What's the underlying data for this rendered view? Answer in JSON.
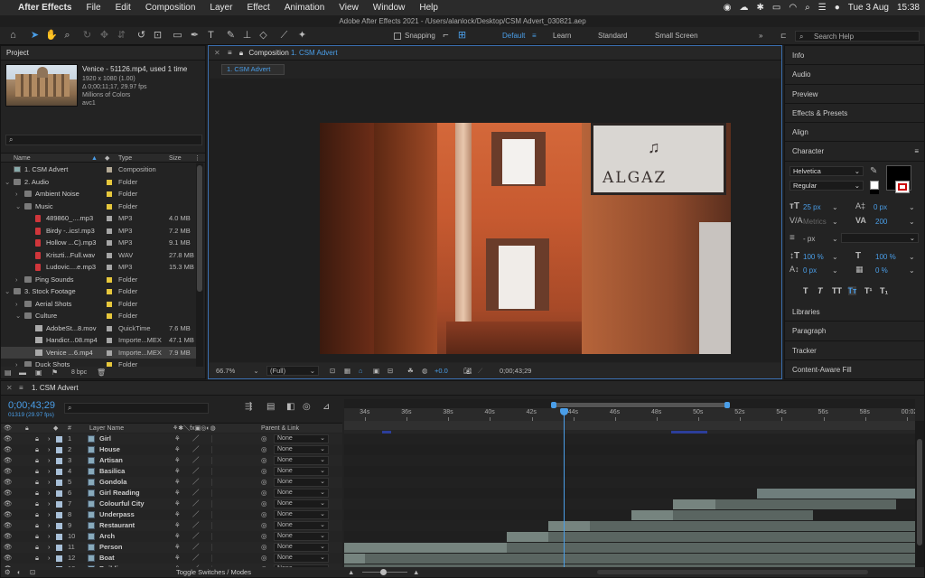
{
  "menubar": {
    "app": "After Effects",
    "items": [
      "File",
      "Edit",
      "Composition",
      "Layer",
      "Effect",
      "Animation",
      "View",
      "Window",
      "Help"
    ],
    "date": "Tue 3 Aug",
    "time": "15:38"
  },
  "window_title": "Adobe After Effects 2021 - /Users/alanlock/Desktop/CSM Advert_030821.aep",
  "toolbar": {
    "snapping": "Snapping",
    "workspaces": [
      "Default",
      "Learn",
      "Standard",
      "Small Screen"
    ],
    "search_placeholder": "Search Help"
  },
  "project": {
    "title": "Project",
    "preview_info": {
      "name": "Venice - 51126.mp4",
      "used": ", used 1 time",
      "res": "1920 x 1080 (1.00)",
      "duration": "Δ 0;00;11;17, 29.97 fps",
      "colors": "Millions of Colors",
      "codec": "avc1"
    },
    "columns": {
      "name": "Name",
      "type": "Type",
      "size": "Size"
    },
    "items": [
      {
        "name": "1. CSM Advert",
        "type": "Composition",
        "size": "",
        "indent": 0,
        "kind": "comp",
        "color": "#b3a995",
        "twirl": ""
      },
      {
        "name": "2. Audio",
        "type": "Folder",
        "size": "",
        "indent": 0,
        "kind": "folder",
        "color": "#e6c73c",
        "twirl": "⌄"
      },
      {
        "name": "Ambient Noise",
        "type": "Folder",
        "size": "",
        "indent": 1,
        "kind": "folder",
        "color": "#e6c73c",
        "twirl": "›"
      },
      {
        "name": "Music",
        "type": "Folder",
        "size": "",
        "indent": 1,
        "kind": "folder",
        "color": "#e6c73c",
        "twirl": "⌄"
      },
      {
        "name": "489860_....mp3",
        "type": "MP3",
        "size": "4.0 MB",
        "indent": 2,
        "kind": "file",
        "color": "#a6a6a6",
        "twirl": ""
      },
      {
        "name": "Birdy -..ics!.mp3",
        "type": "MP3",
        "size": "7.2 MB",
        "indent": 2,
        "kind": "file",
        "color": "#a6a6a6",
        "twirl": ""
      },
      {
        "name": "Hollow ...C).mp3",
        "type": "MP3",
        "size": "9.1 MB",
        "indent": 2,
        "kind": "file",
        "color": "#a6a6a6",
        "twirl": ""
      },
      {
        "name": "Kriszti...Full.wav",
        "type": "WAV",
        "size": "27.8 MB",
        "indent": 2,
        "kind": "file",
        "color": "#a6a6a6",
        "twirl": ""
      },
      {
        "name": "Ludovic....e.mp3",
        "type": "MP3",
        "size": "15.3 MB",
        "indent": 2,
        "kind": "file",
        "color": "#a6a6a6",
        "twirl": ""
      },
      {
        "name": "Ping Sounds",
        "type": "Folder",
        "size": "",
        "indent": 1,
        "kind": "folder",
        "color": "#e6c73c",
        "twirl": "›"
      },
      {
        "name": "3. Stock Footage",
        "type": "Folder",
        "size": "",
        "indent": 0,
        "kind": "folder",
        "color": "#e6c73c",
        "twirl": "⌄"
      },
      {
        "name": "Aerial Shots",
        "type": "Folder",
        "size": "",
        "indent": 1,
        "kind": "folder",
        "color": "#e6c73c",
        "twirl": "›"
      },
      {
        "name": "Culture",
        "type": "Folder",
        "size": "",
        "indent": 1,
        "kind": "folder",
        "color": "#e6c73c",
        "twirl": "⌄"
      },
      {
        "name": "AdobeSt...8.mov",
        "type": "QuickTime",
        "size": "7.6 MB",
        "indent": 2,
        "kind": "vid",
        "color": "#a6a6a6",
        "twirl": ""
      },
      {
        "name": "Handicr...08.mp4",
        "type": "Importe...MEX",
        "size": "47.1 MB",
        "indent": 2,
        "kind": "vid",
        "color": "#a6a6a6",
        "twirl": ""
      },
      {
        "name": "Venice ...6.mp4",
        "type": "Importe...MEX",
        "size": "7.9 MB",
        "indent": 2,
        "kind": "vid",
        "color": "#a6a6a6",
        "twirl": "",
        "selected": true
      },
      {
        "name": "Duck Shots",
        "type": "Folder",
        "size": "",
        "indent": 1,
        "kind": "folder",
        "color": "#e6c73c",
        "twirl": "›"
      }
    ],
    "bpc": "8 bpc"
  },
  "composition": {
    "panel_label": "Composition",
    "comp_name": "1. CSM Advert",
    "tab": "1. CSM Advert",
    "zoom": "66.7%",
    "resolution": "(Full)",
    "exposure": "+0.0",
    "timecode": "0;00;43;29",
    "sign_text": "ALGAZ"
  },
  "sidepanel": {
    "items_top": [
      "Info",
      "Audio",
      "Preview",
      "Effects & Presets",
      "Align"
    ],
    "character": {
      "title": "Character",
      "font": "Helvetica",
      "style": "Regular",
      "size": "25 px",
      "leading": "0 px",
      "kerning": "Metrics",
      "tracking": "200",
      "stroke": "- px",
      "vscale": "100 %",
      "hscale": "100 %",
      "baseline": "0 px",
      "tsume": "0 %"
    },
    "items_bottom": [
      "Libraries",
      "Paragraph",
      "Tracker",
      "Content-Aware Fill"
    ]
  },
  "timeline": {
    "tab": "1. CSM Advert",
    "timecode": "0;00;43;29",
    "frame_info": "01319 (29.97 fps)",
    "col_layer": "Layer Name",
    "col_parent": "Parent & Link",
    "ruler": [
      "34s",
      "36s",
      "38s",
      "40s",
      "42s",
      "44s",
      "46s",
      "48s",
      "50s",
      "52s",
      "54s",
      "56s",
      "58s",
      "00:02f"
    ],
    "toggle": "Toggle Switches / Modes",
    "layers": [
      {
        "num": "1",
        "name": "Girl",
        "color": "#a8c0d8",
        "parent": "None",
        "bars": []
      },
      {
        "num": "2",
        "name": "House",
        "color": "#a8c0d8",
        "parent": "None",
        "bars": []
      },
      {
        "num": "3",
        "name": "Artisan",
        "color": "#a8c0d8",
        "parent": "None",
        "bars": []
      },
      {
        "num": "4",
        "name": "Basilica",
        "color": "#a8c0d8",
        "parent": "None",
        "bars": []
      },
      {
        "num": "5",
        "name": "Gondola",
        "color": "#a8c0d8",
        "parent": "None",
        "bars": []
      },
      {
        "num": "6",
        "name": "Girl Reading",
        "color": "#a8c0d8",
        "parent": "None",
        "bars": [
          {
            "s": 52.8,
            "e": 60.5,
            "c": "#6f7e7c"
          }
        ]
      },
      {
        "num": "7",
        "name": "Colourful City",
        "color": "#a8c0d8",
        "parent": "None",
        "bars": [
          {
            "s": 48.8,
            "e": 50.8,
            "c": "#76847f"
          },
          {
            "s": 50.8,
            "e": 59.5,
            "c": "#5a6561"
          }
        ]
      },
      {
        "num": "8",
        "name": "Underpass",
        "color": "#a8c0d8",
        "parent": "None",
        "bars": [
          {
            "s": 46.8,
            "e": 48.8,
            "c": "#76847f"
          },
          {
            "s": 48.8,
            "e": 55.5,
            "c": "#5a6561"
          }
        ]
      },
      {
        "num": "9",
        "name": "Restaurant",
        "color": "#a8c0d8",
        "parent": "None",
        "bars": [
          {
            "s": 42.8,
            "e": 44.8,
            "c": "#76847f"
          },
          {
            "s": 44.8,
            "e": 60.5,
            "c": "#5a6561"
          }
        ]
      },
      {
        "num": "10",
        "name": "Arch",
        "color": "#a8c0d8",
        "parent": "None",
        "bars": [
          {
            "s": 40.8,
            "e": 42.8,
            "c": "#76847f"
          },
          {
            "s": 42.8,
            "e": 60.5,
            "c": "#5a6561"
          }
        ]
      },
      {
        "num": "11",
        "name": "Person",
        "color": "#a8c0d8",
        "parent": "None",
        "bars": [
          {
            "s": 33.0,
            "e": 40.8,
            "c": "#76847f"
          },
          {
            "s": 40.8,
            "e": 60.5,
            "c": "#5a6561"
          }
        ]
      },
      {
        "num": "12",
        "name": "Boat",
        "color": "#a8c0d8",
        "parent": "None",
        "bars": [
          {
            "s": 33.0,
            "e": 34.0,
            "c": "#76847f"
          },
          {
            "s": 34.0,
            "e": 60.5,
            "c": "#5a6561"
          }
        ]
      },
      {
        "num": "13",
        "name": "Building",
        "color": "#a8c0d8",
        "parent": "None",
        "bars": [
          {
            "s": 33.0,
            "e": 60.5,
            "c": "#5a6561"
          }
        ]
      }
    ]
  }
}
